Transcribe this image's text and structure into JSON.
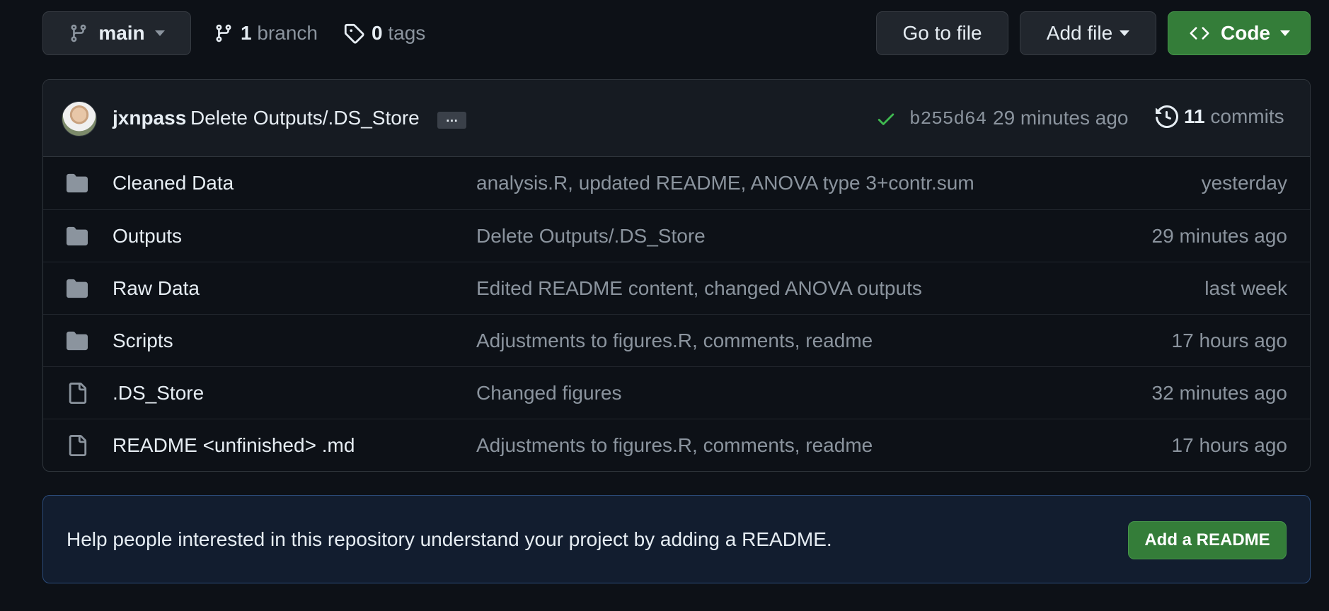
{
  "toolbar": {
    "branch_name": "main",
    "branch_count": "1",
    "branch_label": "branch",
    "tag_count": "0",
    "tag_label": "tags",
    "go_to_file": "Go to file",
    "add_file": "Add file",
    "code": "Code"
  },
  "commit": {
    "author": "jxnpass",
    "message": "Delete Outputs/.DS_Store",
    "ellipsis": "…",
    "status": "success",
    "sha": "b255d64",
    "time": "29 minutes ago",
    "commit_count": "11",
    "commit_label": "commits"
  },
  "files": [
    {
      "icon": "folder-icon",
      "name": "Cleaned Data",
      "message": "analysis.R, updated README, ANOVA type 3+contr.sum",
      "time": "yesterday"
    },
    {
      "icon": "folder-icon",
      "name": "Outputs",
      "message": "Delete Outputs/.DS_Store",
      "time": "29 minutes ago"
    },
    {
      "icon": "folder-icon",
      "name": "Raw Data",
      "message": "Edited README content, changed ANOVA outputs",
      "time": "last week"
    },
    {
      "icon": "folder-icon",
      "name": "Scripts",
      "message": "Adjustments to figures.R, comments, readme",
      "time": "17 hours ago"
    },
    {
      "icon": "file-icon",
      "name": ".DS_Store",
      "message": "Changed figures",
      "time": "32 minutes ago"
    },
    {
      "icon": "file-icon",
      "name": "README <unfinished> .md",
      "message": "Adjustments to figures.R, comments, readme",
      "time": "17 hours ago"
    }
  ],
  "readme_prompt": {
    "text": "Help people interested in this repository understand your project by adding a README.",
    "button": "Add a README"
  },
  "colors": {
    "background": "#0d1117",
    "button_green": "#347d39",
    "check_green": "#3fb950",
    "muted_text": "#8b949e"
  }
}
